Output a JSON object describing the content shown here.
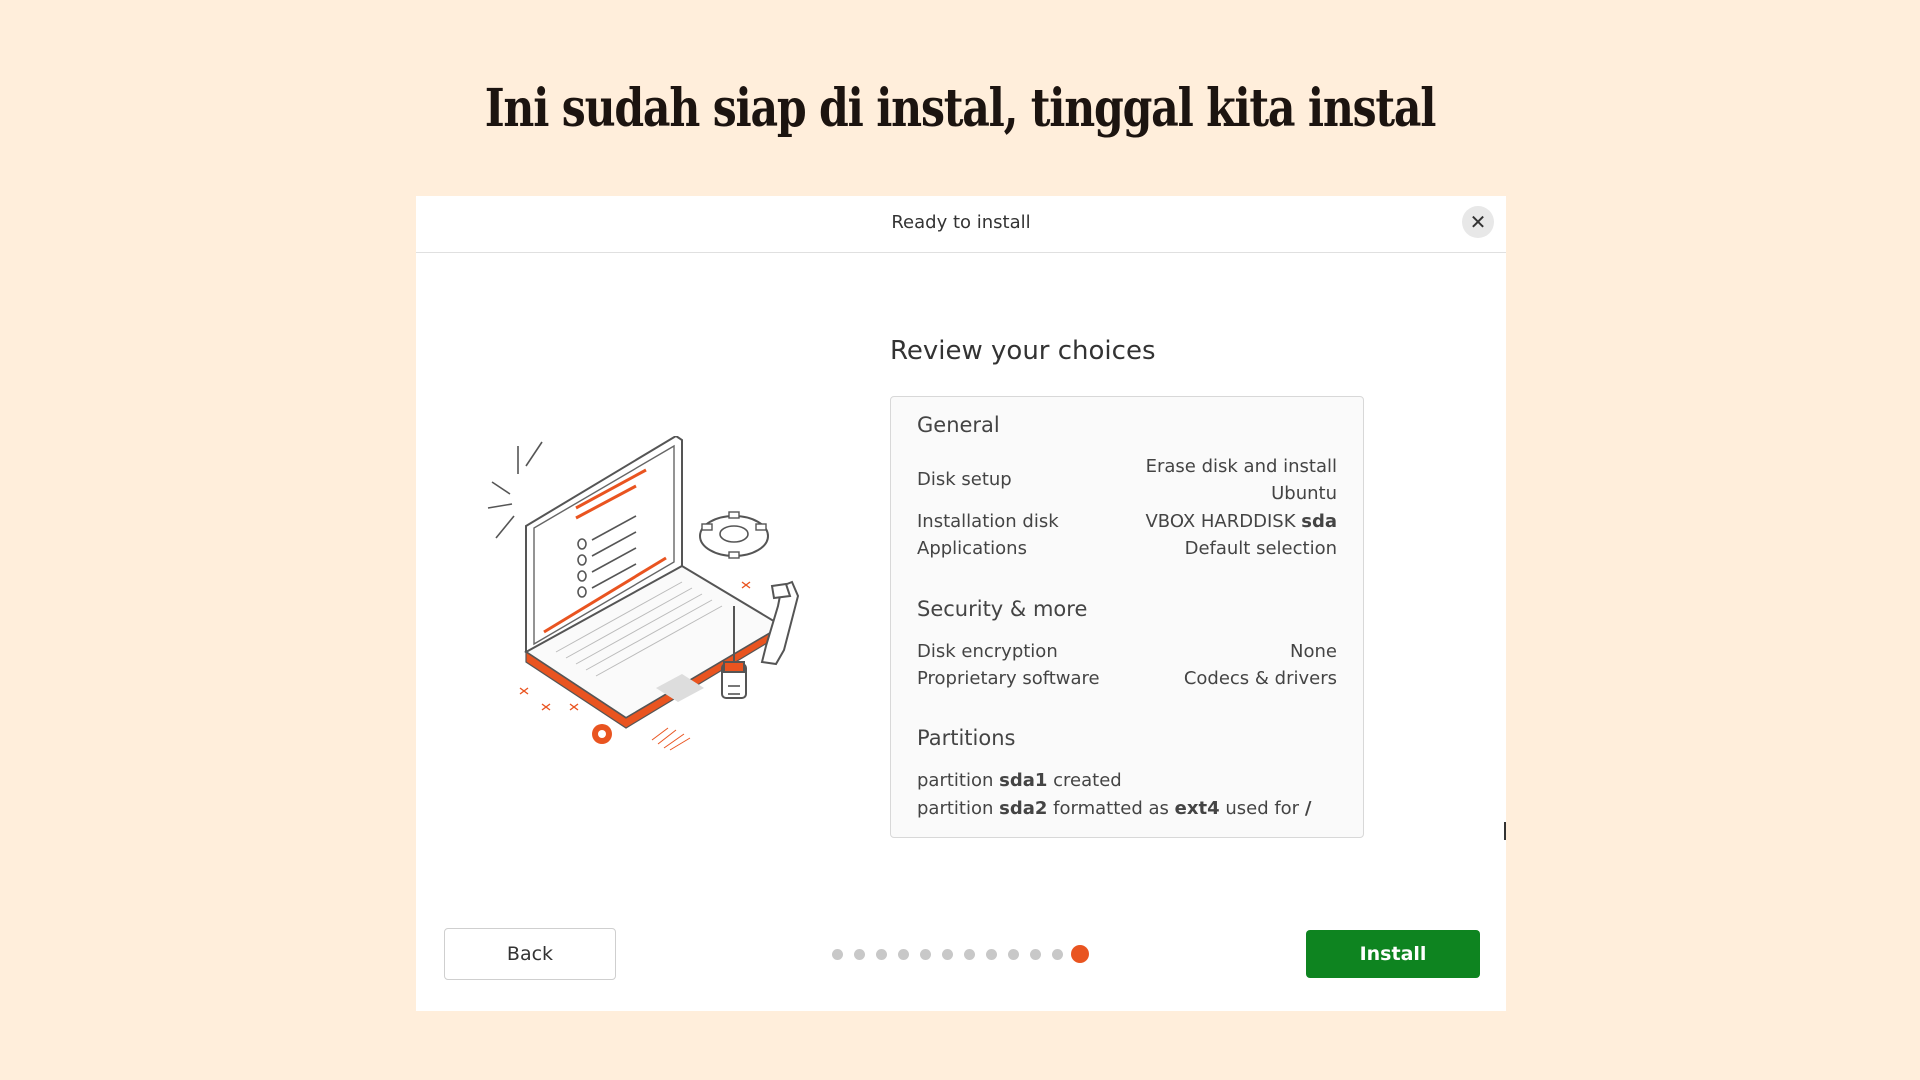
{
  "slide": {
    "title": "Ini sudah siap di instal, tinggal kita instal"
  },
  "window": {
    "title": "Ready to install",
    "close_icon": "close-icon"
  },
  "review": {
    "heading": "Review your choices",
    "general": {
      "title": "General",
      "disk_setup_label": "Disk setup",
      "disk_setup_value_line1": "Erase disk and install",
      "disk_setup_value_line2": "Ubuntu",
      "installation_disk_label": "Installation disk",
      "installation_disk_value": "VBOX HARDDISK",
      "installation_disk_device": "sda",
      "applications_label": "Applications",
      "applications_value": "Default selection"
    },
    "security": {
      "title": "Security & more",
      "disk_encryption_label": "Disk encryption",
      "disk_encryption_value": "None",
      "proprietary_label": "Proprietary software",
      "proprietary_value": "Codecs & drivers"
    },
    "partitions": {
      "title": "Partitions",
      "p1_word": "partition",
      "p1_name": "sda1",
      "p1_action": "created",
      "p2_word": "partition",
      "p2_name": "sda2",
      "p2_action": "formatted as",
      "p2_fs": "ext4",
      "p2_used": "used for",
      "p2_mount": "/"
    }
  },
  "buttons": {
    "back": "Back",
    "install": "Install"
  },
  "progress": {
    "total_steps": 12,
    "current_step": 12
  },
  "colors": {
    "accent": "#e95420",
    "install_green": "#0e8420",
    "background": "#ffeedb"
  },
  "icons": {
    "illustration": "laptop-tools-illustration"
  }
}
